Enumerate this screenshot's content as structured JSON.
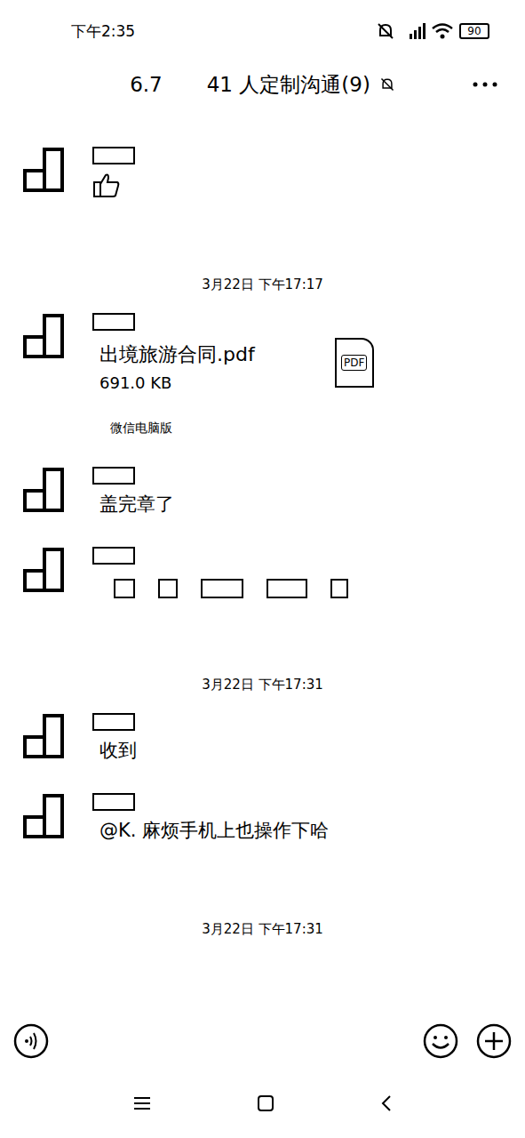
{
  "status_bar": {
    "time": "下午2:35",
    "battery": "90",
    "muted": true
  },
  "header": {
    "prefix": "6.7",
    "title": "41 人定制沟通(9)",
    "muted": true
  },
  "messages": [
    {
      "kind": "sticker"
    },
    {
      "kind": "time",
      "text": "3月22日 下午17:17"
    },
    {
      "kind": "file",
      "file_name": "出境旅游合同.pdf",
      "file_size": "691.0 KB",
      "file_type": "PDF",
      "source": "微信电脑版"
    },
    {
      "kind": "text",
      "text": "盖完章了"
    },
    {
      "kind": "redacted"
    },
    {
      "kind": "time",
      "text": "3月22日 下午17:31"
    },
    {
      "kind": "text",
      "text": "收到"
    },
    {
      "kind": "text",
      "text": "@K. 麻烦手机上也操作下哈"
    },
    {
      "kind": "time",
      "text": "3月22日 下午17:31"
    }
  ]
}
